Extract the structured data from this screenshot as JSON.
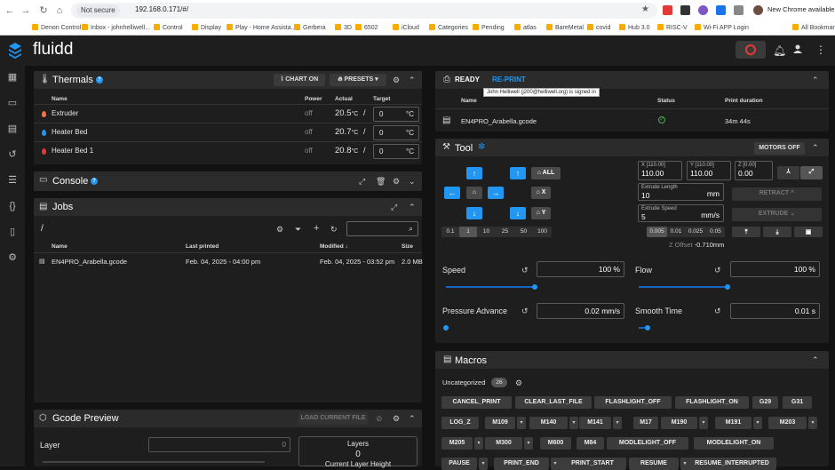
{
  "browser": {
    "not_secure": "Not secure",
    "url": "192.168.0.171/#/",
    "chrome_update": "New Chrome available",
    "bookmarks": [
      "Denon Control",
      "Inbox - johnhelliwell...",
      "Control",
      "Display",
      "Play - Home Assista...",
      "Gerbera",
      "3D",
      "6502",
      "iCloud",
      "Categories",
      "Pending",
      "atlas",
      "BareMetal",
      "covid",
      "Hub 3.0",
      "RISC-V",
      "Wi-Fi APP Login",
      "All Bookmarks"
    ]
  },
  "app": {
    "title": "fluidd"
  },
  "colors": {
    "accent": "#2196f3",
    "danger": "#e53935",
    "ok": "#4caf50"
  },
  "thermals": {
    "title": "Thermals",
    "chart_btn": "CHART ON",
    "presets_btn": "PRESETS",
    "headers": {
      "name": "Name",
      "power": "Power",
      "actual": "Actual",
      "target": "Target"
    },
    "rows": [
      {
        "name": "Extruder",
        "power": "off",
        "actual": "20.5",
        "unit": "°C",
        "sep": "/",
        "target": "0",
        "tunit": "°C",
        "color": "#ff7043"
      },
      {
        "name": "Heater Bed",
        "power": "off",
        "actual": "20.7",
        "unit": "°C",
        "sep": "/",
        "target": "0",
        "tunit": "°C",
        "color": "#2196f3"
      },
      {
        "name": "Heater Bed 1",
        "power": "off",
        "actual": "20.8",
        "unit": "°C",
        "sep": "/",
        "target": "0",
        "tunit": "°C",
        "color": "#e53935"
      }
    ]
  },
  "console": {
    "title": "Console"
  },
  "jobs": {
    "title": "Jobs",
    "path": "/",
    "headers": {
      "name": "Name",
      "last_printed": "Last printed",
      "modified": "Modified ↓",
      "size": "Size"
    },
    "files": [
      {
        "name": "EN4PRO_Arabella.gcode",
        "last_printed": "Feb. 04, 2025 - 04:00 pm",
        "modified": "Feb. 04, 2025 - 03:52 pm",
        "size": "2.0 MB"
      }
    ]
  },
  "gcode_preview": {
    "title": "Gcode Preview",
    "load_btn": "LOAD CURRENT FILE",
    "layer_label": "Layer",
    "layer_value": "0",
    "layers_label": "Layers",
    "layers_value": "0",
    "current_height_label": "Current Layer Height"
  },
  "status": {
    "ready": "READY",
    "reprint": "RE-PRINT",
    "tooltip": "John Helliwell (j200@helliwell.org) is signed in",
    "headers": {
      "name": "Name",
      "status": "Status",
      "duration": "Print duration"
    },
    "job": {
      "name": "EN4PRO_Arabella.gcode",
      "duration": "34m 44s"
    }
  },
  "tool": {
    "title": "Tool",
    "motors_off": "MOTORS OFF",
    "all": "ALL",
    "x": "X",
    "y": "Y",
    "steps_xy": [
      "0.1",
      "1",
      "10",
      "25",
      "50",
      "100"
    ],
    "steps_z": [
      "0.005",
      "0.01",
      "0.025",
      "0.05"
    ],
    "pos": [
      {
        "label": "X [110.00]",
        "value": "110.00"
      },
      {
        "label": "Y [110.00]",
        "value": "110.00"
      },
      {
        "label": "Z [0.00]",
        "value": "0.00"
      }
    ],
    "extrude_length_label": "Extrude Length",
    "extrude_length": "10",
    "extrude_length_unit": "mm",
    "extrude_speed_label": "Extrude Speed",
    "extrude_speed": "5",
    "extrude_speed_unit": "mm/s",
    "retract_btn": "RETRACT ^",
    "extrude_btn": "EXTRUDE ⌄",
    "z_offset_label": "Z Offset",
    "z_offset": "-0.710mm",
    "speed_label": "Speed",
    "speed_value": "100 %",
    "speed_level": 0.5,
    "flow_label": "Flow",
    "flow_value": "100 %",
    "flow_level": 0.5,
    "pa_label": "Pressure Advance",
    "pa_value": "0.02 mm/s",
    "pa_level": 0.0,
    "st_label": "Smooth Time",
    "st_value": "0.01 s",
    "st_level": 0.05
  },
  "macros": {
    "title": "Macros",
    "category": "Uncategorized",
    "count": "26",
    "buttons": [
      "CANCEL_PRINT",
      "CLEAR_LAST_FILE",
      "FLASHLIGHT_OFF",
      "FLASHLIGHT_ON",
      "G29",
      "G31",
      "LOG_Z",
      "M109",
      "M140",
      "M141",
      "M17",
      "M190",
      "M191",
      "M203",
      "M205",
      "M300",
      "M600",
      "M84",
      "MODLELIGHT_OFF",
      "MODLELIGHT_ON",
      "PAUSE",
      "PRINT_END",
      "PRINT_START",
      "RESUME",
      "RESUME_INTERRUPTED"
    ]
  }
}
